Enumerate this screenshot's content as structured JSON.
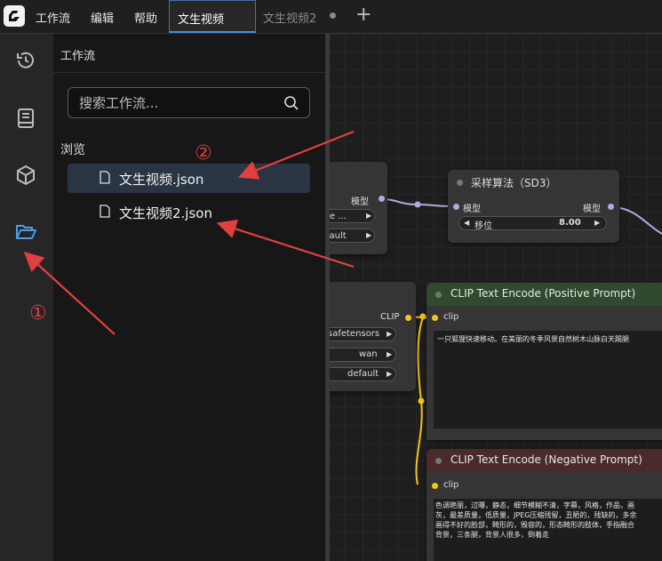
{
  "topbar": {
    "menu": [
      "工作流",
      "编辑",
      "帮助"
    ],
    "tabs": [
      {
        "label": "文生视频",
        "active": true
      },
      {
        "label": "文生视频2",
        "active": false
      }
    ],
    "add_tab": "+"
  },
  "rail": {
    "icons": [
      "history-icon",
      "book-icon",
      "cube-icon",
      "folder-open-icon"
    ],
    "active": "folder-open-icon"
  },
  "panel": {
    "title": "工作流",
    "search_placeholder": "搜索工作流...",
    "browse_label": "浏览",
    "files": [
      "文生视频.json",
      "文生视频2.json"
    ]
  },
  "canvas": {
    "node_left_partial": {
      "output_label": "模型",
      "widgets": [
        "te ...",
        "fault"
      ]
    },
    "sampling_node": {
      "title": "采样算法（SD3）",
      "input_label": "模型",
      "output_label": "模型",
      "widget_label": "移位",
      "widget_value": "8.00"
    },
    "clip_loader_partial": {
      "output_label": "CLIP",
      "widgets": [
        "safetensors",
        "wan",
        "default"
      ]
    },
    "positive_node": {
      "title": "CLIP Text Encode (Positive Prompt)",
      "input_label": "clip",
      "text": "一只狐狸快速移动。在美丽的冬季风景自然树木山脉白天踢腿"
    },
    "negative_node": {
      "title": "CLIP Text Encode (Negative Prompt)",
      "input_label": "clip",
      "text_lines": [
        "色调艳丽，过曝，静态，细节模糊不清，字幕，风格，作品，画",
        "灰，最差质量，低质量，JPEG压缩残留，丑陋的，残缺的，多余",
        "画得不好的脸部，畸形的，毁容的，形态畸形的肢体，手指融合",
        "背景，三条腿，背景人很多，倒着走"
      ]
    }
  },
  "annotations": [
    "②",
    "①"
  ],
  "colors": {
    "accent_blue": "#4a9eea",
    "positive_node": "#2f4a2f",
    "negative_node": "#4a2a2a",
    "clip_link": "#f5c518",
    "model_link": "#b9a6e0",
    "annotation_red": "#e04040"
  }
}
